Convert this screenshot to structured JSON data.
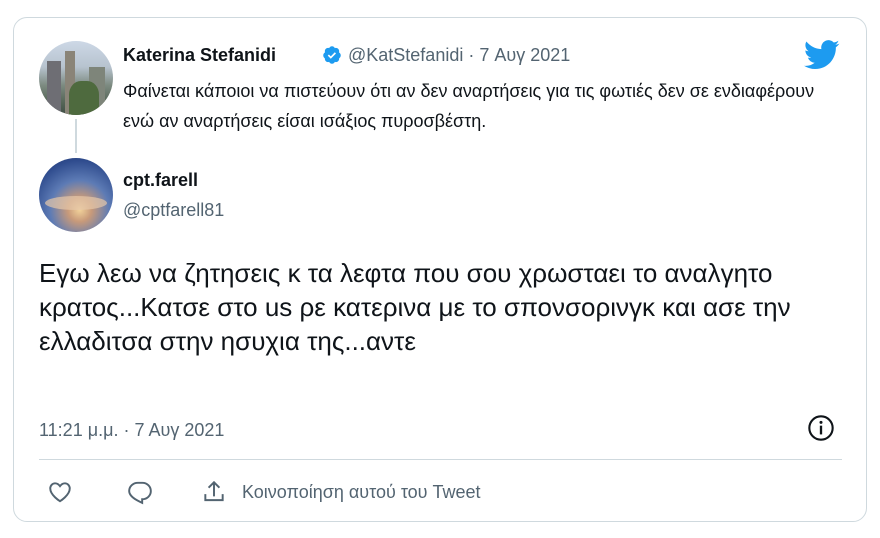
{
  "quoted": {
    "name": "Katerina Stefanidi",
    "handle_date": "@KatStefanidi · 7 Αυγ 2021",
    "text": "Φαίνεται κάποιοι να πιστεύουν ότι αν δεν αναρτήσεις για τις φωτιές δεν σε ενδιαφέρουν ενώ αν αναρτήσεις είσαι ισάξιος πυροσβέστη."
  },
  "reply": {
    "name": "cpt.farell",
    "handle": "@cptfarell81",
    "text": "Εγω λεω να ζητησεις κ τα λεφτα που σου χρωσταει το αναλγητο κρατος...Κατσε στο us ρε κατερινα με το σπονσορινγκ και ασε την ελλαδιτσα στην ησυχια της...αντε",
    "timestamp": "11:21 μ.μ. · 7 Αυγ 2021"
  },
  "actions": {
    "share_label": "Κοινοποίηση αυτού του Tweet"
  },
  "colors": {
    "twitter_blue": "#1d9bf0",
    "secondary_text": "#536471",
    "border": "#cfd9de"
  },
  "icons": [
    "verified-badge-icon",
    "twitter-bird-icon",
    "info-icon",
    "heart-icon",
    "reply-icon",
    "share-icon"
  ]
}
